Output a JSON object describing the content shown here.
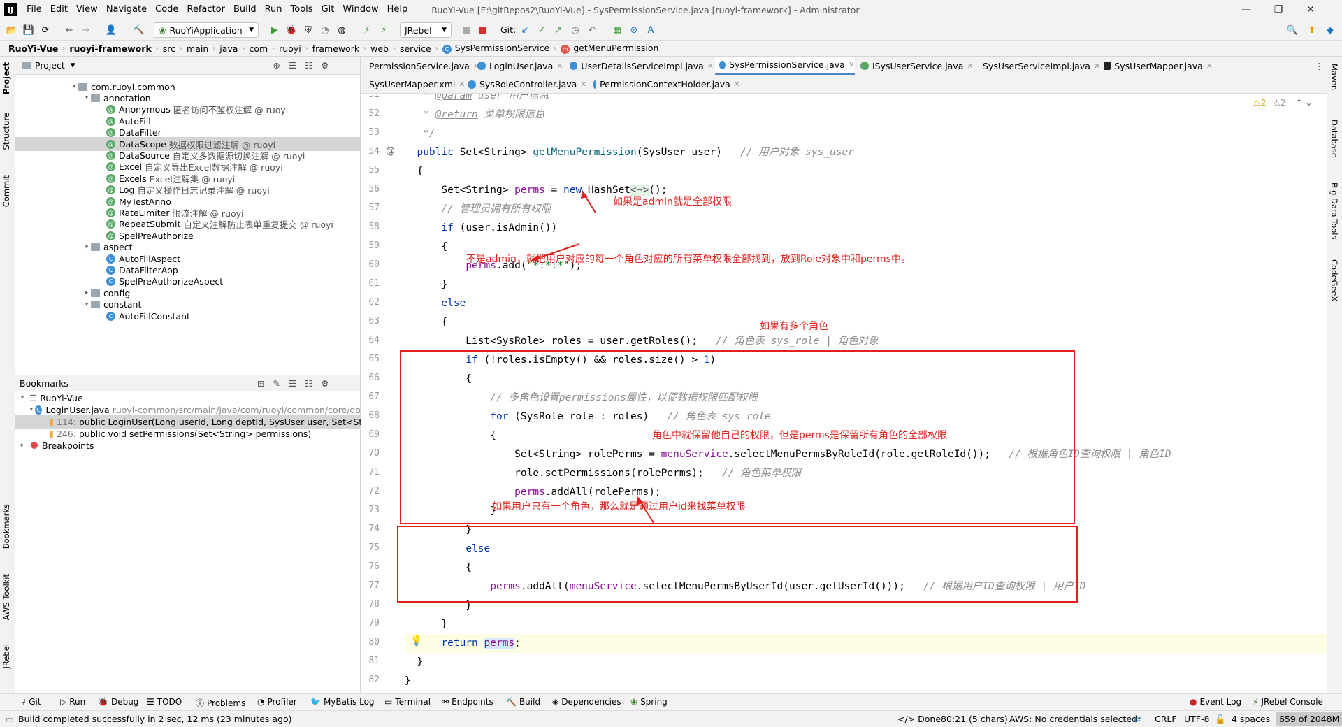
{
  "menu": {
    "logo": "IJ",
    "items": [
      "File",
      "Edit",
      "View",
      "Navigate",
      "Code",
      "Refactor",
      "Build",
      "Run",
      "Tools",
      "Git",
      "Window",
      "Help"
    ],
    "window_title": "RuoYi-Vue [E:\\gitRepos2\\RuoYi-Vue] - SysPermissionService.java [ruoyi-framework] - Administrator"
  },
  "toolbar": {
    "run_config": "RuoYiApplication",
    "jrebel": "JRebel",
    "git_label": "Git:"
  },
  "breadcrumb": [
    "RuoYi-Vue",
    "ruoyi-framework",
    "src",
    "main",
    "java",
    "com",
    "ruoyi",
    "framework",
    "web",
    "service",
    "SysPermissionService",
    "getMenuPermission"
  ],
  "left_strip": [
    "Project",
    "Structure",
    "Commit",
    "Bookmarks",
    "AWS Toolkit",
    "JRebel"
  ],
  "right_strip": [
    "Maven",
    "Database",
    "Big Data Tools",
    "CodeGeeX"
  ],
  "project": {
    "title": "Project",
    "rows": [
      {
        "label": "com.ruoyi.common",
        "desc": "",
        "type": "pkg",
        "arrow": "▾",
        "indent": 0
      },
      {
        "label": "annotation",
        "desc": "",
        "type": "pkg",
        "arrow": "▾",
        "indent": 1
      },
      {
        "label": "Anonymous",
        "desc": "匿名访问不鉴权注解 @ ruoyi",
        "type": "ann",
        "arrow": "",
        "indent": 2
      },
      {
        "label": "AutoFill",
        "desc": "",
        "type": "ann",
        "arrow": "",
        "indent": 2
      },
      {
        "label": "DataFilter",
        "desc": "",
        "type": "ann",
        "arrow": "",
        "indent": 2
      },
      {
        "label": "DataScope",
        "desc": "数据权限过滤注解 @ ruoyi",
        "type": "ann",
        "arrow": "",
        "indent": 2,
        "selected": true
      },
      {
        "label": "DataSource",
        "desc": "自定义多数据源切换注解 @ ruoyi",
        "type": "ann",
        "arrow": "",
        "indent": 2
      },
      {
        "label": "Excel",
        "desc": "自定义导出Excel数据注解 @ ruoyi",
        "type": "ann",
        "arrow": "",
        "indent": 2
      },
      {
        "label": "Excels",
        "desc": "Excel注解集 @ ruoyi",
        "type": "ann",
        "arrow": "",
        "indent": 2
      },
      {
        "label": "Log",
        "desc": "自定义操作日志记录注解 @ ruoyi",
        "type": "ann",
        "arrow": "",
        "indent": 2
      },
      {
        "label": "MyTestAnno",
        "desc": "",
        "type": "ann",
        "arrow": "",
        "indent": 2
      },
      {
        "label": "RateLimiter",
        "desc": "限流注解 @ ruoyi",
        "type": "ann",
        "arrow": "",
        "indent": 2
      },
      {
        "label": "RepeatSubmit",
        "desc": "自定义注解防止表单重复提交 @ ruoyi",
        "type": "ann",
        "arrow": "",
        "indent": 2
      },
      {
        "label": "SpelPreAuthorize",
        "desc": "",
        "type": "ann",
        "arrow": "",
        "indent": 2
      },
      {
        "label": "aspect",
        "desc": "",
        "type": "pkg",
        "arrow": "▾",
        "indent": 1
      },
      {
        "label": "AutoFillAspect",
        "desc": "",
        "type": "cls",
        "arrow": "",
        "indent": 2
      },
      {
        "label": "DataFilterAop",
        "desc": "",
        "type": "cls",
        "arrow": "",
        "indent": 2
      },
      {
        "label": "SpelPreAuthorizeAspect",
        "desc": "",
        "type": "cls",
        "arrow": "",
        "indent": 2
      },
      {
        "label": "config",
        "desc": "",
        "type": "pkg",
        "arrow": "▸",
        "indent": 1
      },
      {
        "label": "constant",
        "desc": "",
        "type": "pkg",
        "arrow": "▾",
        "indent": 1
      },
      {
        "label": "AutoFillConstant",
        "desc": "",
        "type": "cls",
        "arrow": "",
        "indent": 2
      }
    ]
  },
  "bookmarks": {
    "title": "Bookmarks",
    "root": "RuoYi-Vue",
    "file": "LoginUser.java",
    "file_path": "ruoyi-common/src/main/java/com/ruoyi/common/core/do",
    "items": [
      {
        "line": "114:",
        "text": "public LoginUser(Long userId, Long deptId, SysUser user, Set<Stri"
      },
      {
        "line": "246:",
        "text": "public void setPermissions(Set<String> permissions)"
      }
    ],
    "breakpoints": "Breakpoints"
  },
  "tabs_row1": [
    "PermissionService.java",
    "LoginUser.java",
    "UserDetailsServiceImpl.java",
    "SysPermissionService.java",
    "ISysUserService.java",
    "SysUserServiceImpl.java",
    "SysUserMapper.java"
  ],
  "tabs_row2": [
    "SysUserMapper.xml",
    "SysRoleController.java",
    "PermissionContextHolder.java"
  ],
  "editor": {
    "warnings": "⚠2",
    "weak_warnings": "⚠2",
    "line_numbers": [
      "51",
      "52",
      "53",
      "54",
      "55",
      "56",
      "57",
      "58",
      "59",
      "60",
      "61",
      "62",
      "63",
      "64",
      "65",
      "66",
      "67",
      "68",
      "69",
      "70",
      "71",
      "72",
      "73",
      "74",
      "75",
      "76",
      "77",
      "78",
      "79",
      "80",
      "81",
      "82"
    ]
  },
  "annotations": {
    "a1": "如果是admin就是全部权限",
    "a2": "不是admin，就把用户对应的每一个角色对应的所有菜单权限全部找到，放到Role对象中和perms中。",
    "a3": "如果有多个角色",
    "a4": "角色中就保留他自己的权限，但是perms是保留所有角色的全部权限",
    "a5": "如果用户只有一个角色，那么就是通过用户id来找菜单权限"
  },
  "bottom_tools": [
    "Git",
    "Run",
    "Debug",
    "TODO",
    "Problems",
    "Profiler",
    "MyBatis Log",
    "Terminal",
    "Endpoints",
    "Build",
    "Dependencies",
    "Spring",
    "Event Log",
    "JRebel Console"
  ],
  "status": {
    "message": "Build completed successfully in 2 sec, 12 ms (23 minutes ago)",
    "done": "Done",
    "position": "80:21 (5 chars)",
    "aws": "AWS: No credentials selected",
    "line_sep": "CRLF",
    "encoding": "UTF-8",
    "indent": "4 spaces",
    "memory": "659 of 2048M"
  }
}
